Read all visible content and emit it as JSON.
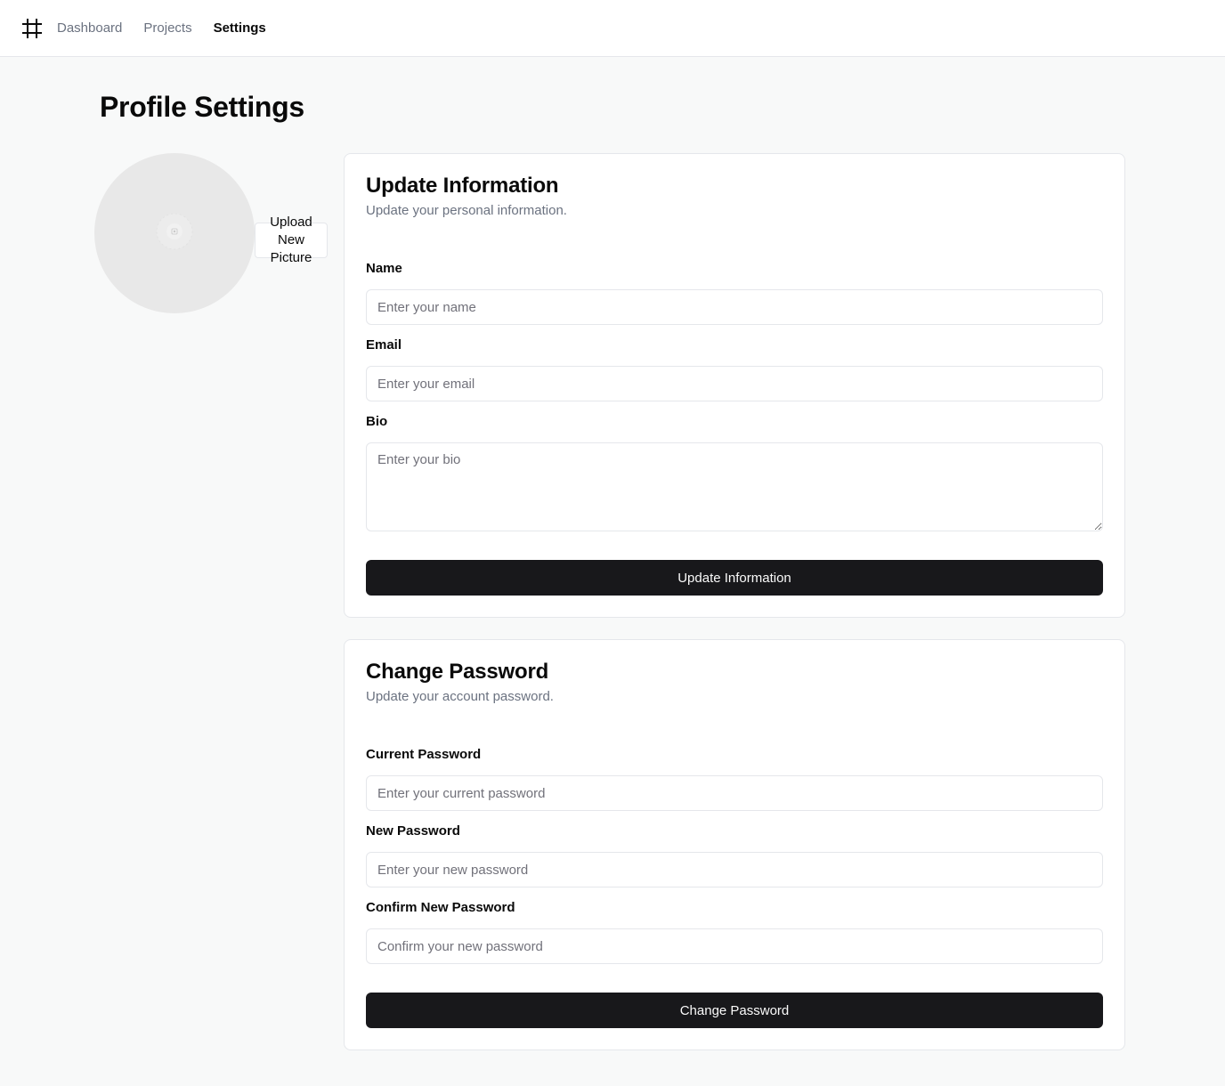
{
  "nav": {
    "logo_icon": "hash-icon",
    "links": [
      {
        "label": "Dashboard",
        "active": false
      },
      {
        "label": "Projects",
        "active": false
      },
      {
        "label": "Settings",
        "active": true
      }
    ]
  },
  "page": {
    "title": "Profile Settings"
  },
  "profile_picture": {
    "avatar_icon": "image-placeholder-icon",
    "upload_label": "Upload New Picture"
  },
  "update_info": {
    "title": "Update Information",
    "subtitle": "Update your personal information.",
    "name_label": "Name",
    "name_placeholder": "Enter your name",
    "email_label": "Email",
    "email_placeholder": "Enter your email",
    "bio_label": "Bio",
    "bio_placeholder": "Enter your bio",
    "submit_label": "Update Information"
  },
  "change_password": {
    "title": "Change Password",
    "subtitle": "Update your account password.",
    "current_label": "Current Password",
    "current_placeholder": "Enter your current password",
    "new_label": "New Password",
    "new_placeholder": "Enter your new password",
    "confirm_label": "Confirm New Password",
    "confirm_placeholder": "Confirm your new password",
    "submit_label": "Change Password"
  },
  "colors": {
    "background": "#f8f9f9",
    "button": "#18181b",
    "muted_text": "#6b7280",
    "border": "#e5e7eb"
  }
}
